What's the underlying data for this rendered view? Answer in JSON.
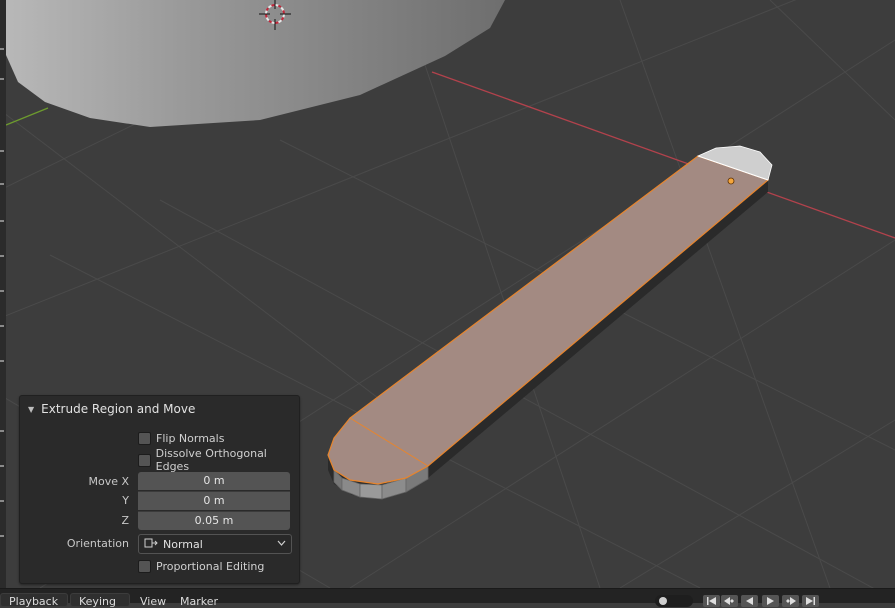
{
  "operator_panel": {
    "title": "Extrude Region and Move",
    "flip_normals": {
      "label": "Flip Normals",
      "checked": false
    },
    "dissolve_orthogonal_edges": {
      "label": "Dissolve Orthogonal Edges",
      "checked": false
    },
    "move": {
      "x_label": "Move X",
      "x_value": "0 m",
      "y_label": "Y",
      "y_value": "0 m",
      "z_label": "Z",
      "z_value": "0.05 m"
    },
    "orientation": {
      "label": "Orientation",
      "value": "Normal",
      "icon": "orientation-normal-icon"
    },
    "proportional_editing": {
      "label": "Proportional Editing",
      "checked": false
    }
  },
  "timeline_bar": {
    "menus": [
      "Playback",
      "Keying",
      "View",
      "Marker"
    ],
    "playback_buttons": [
      "jump-start-icon",
      "prev-keyframe-icon",
      "play-reverse-icon",
      "play-icon",
      "next-keyframe-icon",
      "jump-end-icon"
    ]
  },
  "colors": {
    "viewport_bg": "#3d3d3d",
    "grid_line": "#4a4a4a",
    "x_axis": "#b2424c",
    "y_axis": "#6d9b2e",
    "selected_face": "#a38a82",
    "selected_edge": "#e8852c",
    "panel_bg": "#2a2a2a"
  }
}
